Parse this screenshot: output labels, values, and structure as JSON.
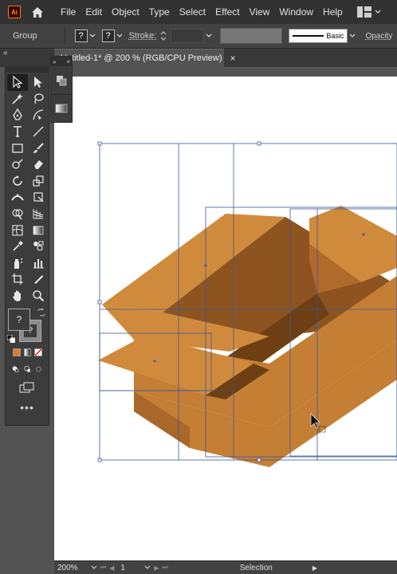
{
  "app": {
    "logo": "Ai"
  },
  "menu": [
    "File",
    "Edit",
    "Object",
    "Type",
    "Select",
    "Effect",
    "View",
    "Window",
    "Help"
  ],
  "control_bar": {
    "selection_label": "Group",
    "fill_value": "?",
    "stroke_value": "?",
    "stroke_label": "Stroke:",
    "brush_label": "Basic",
    "opacity_label": "Opacity"
  },
  "document": {
    "tab_title": "Untitled-1* @ 200 % (RGB/CPU Preview)",
    "close_symbol": "×"
  },
  "toolbar": {
    "collapse_symbol": "«",
    "fill_label": "?",
    "stroke_label": "?",
    "more_symbol": "•••"
  },
  "flyout": {
    "collapse_symbol": "»",
    "close_symbol": "×"
  },
  "status": {
    "zoom": "200%",
    "page": "1",
    "tool": "Selection"
  },
  "colors": {
    "box_top": "#d08a3c",
    "box_front": "#c47f35",
    "box_side": "#a9672a",
    "box_inside_dark": "#6e3f12",
    "box_inside_mid": "#8d5420",
    "selection": "#3b5998"
  }
}
